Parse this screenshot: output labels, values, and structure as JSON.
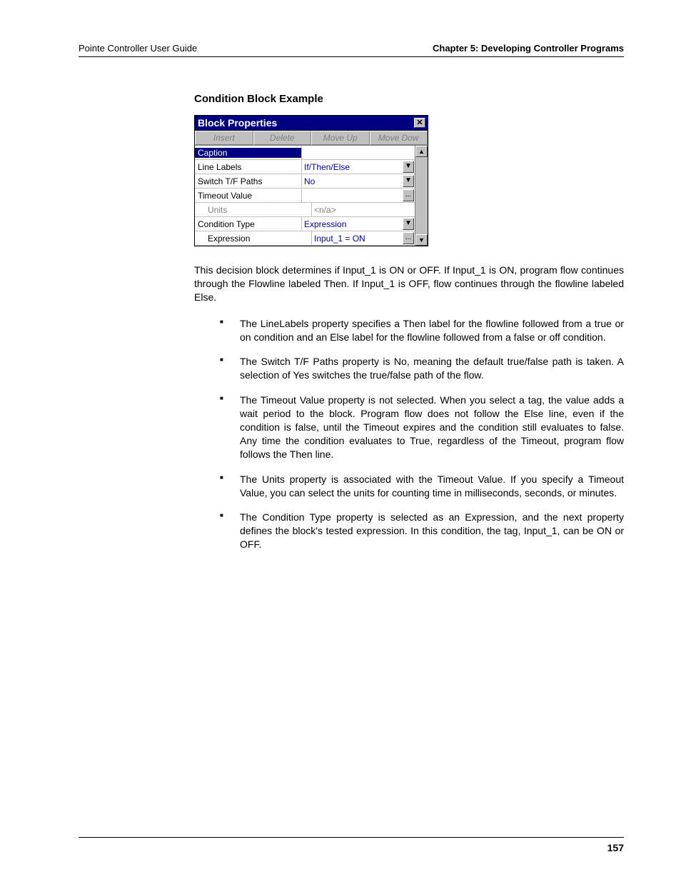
{
  "header": {
    "left": "Pointe Controller User Guide",
    "right": "Chapter 5: Developing Controller Programs"
  },
  "section_title": "Condition Block Example",
  "block_properties": {
    "title": "Block Properties",
    "toolbar": [
      "Insert",
      "Delete",
      "Move Up",
      "Move Dow"
    ],
    "rows": [
      {
        "label": "Caption",
        "value": "",
        "selected": true,
        "ctrl": ""
      },
      {
        "label": "Line Labels",
        "value": "If/Then/Else",
        "ctrl": "▼"
      },
      {
        "label": "Switch T/F Paths",
        "value": "No",
        "ctrl": "▼"
      },
      {
        "label": "Timeout Value",
        "value": "",
        "ctrl": "..."
      },
      {
        "label": "Units",
        "value": "<n/a>",
        "indent": true,
        "gray": true
      },
      {
        "label": "Condition Type",
        "value": "Expression",
        "ctrl": "▼"
      },
      {
        "label": "Expression",
        "value": "Input_1 =  ON",
        "indent2": true,
        "ctrl": "..."
      }
    ]
  },
  "paragraph": "This decision block determines if  Input_1 is ON or OFF. If Input_1 is ON, program flow continues through the Flowline labeled Then. If Input_1 is OFF, flow continues through the flowline labeled Else.",
  "bullets": [
    "The LineLabels property specifies a Then label for the flowline followed from a true or on condition and an Else label for the flowline followed from a false or off condition.",
    "The Switch T/F Paths property is No, meaning the default true/false path is taken. A selection of Yes switches the true/false path of the flow.",
    "The Timeout Value property is not selected. When you select a tag, the value adds a wait period to the block. Program flow does not follow the Else line, even if the condition is false, until the Timeout expires and the condition still evaluates to false. Any time the condition evaluates to True, regardless of the Timeout, program flow follows the Then line.",
    "The Units property is associated with the Timeout Value. If you specify a Timeout Value, you can select the units for counting time in milliseconds, seconds, or minutes.",
    "The Condition Type property is selected as an Expression, and the next property defines the block's tested expression. In this condition, the tag, Input_1, can be ON or OFF."
  ],
  "page_number": "157"
}
